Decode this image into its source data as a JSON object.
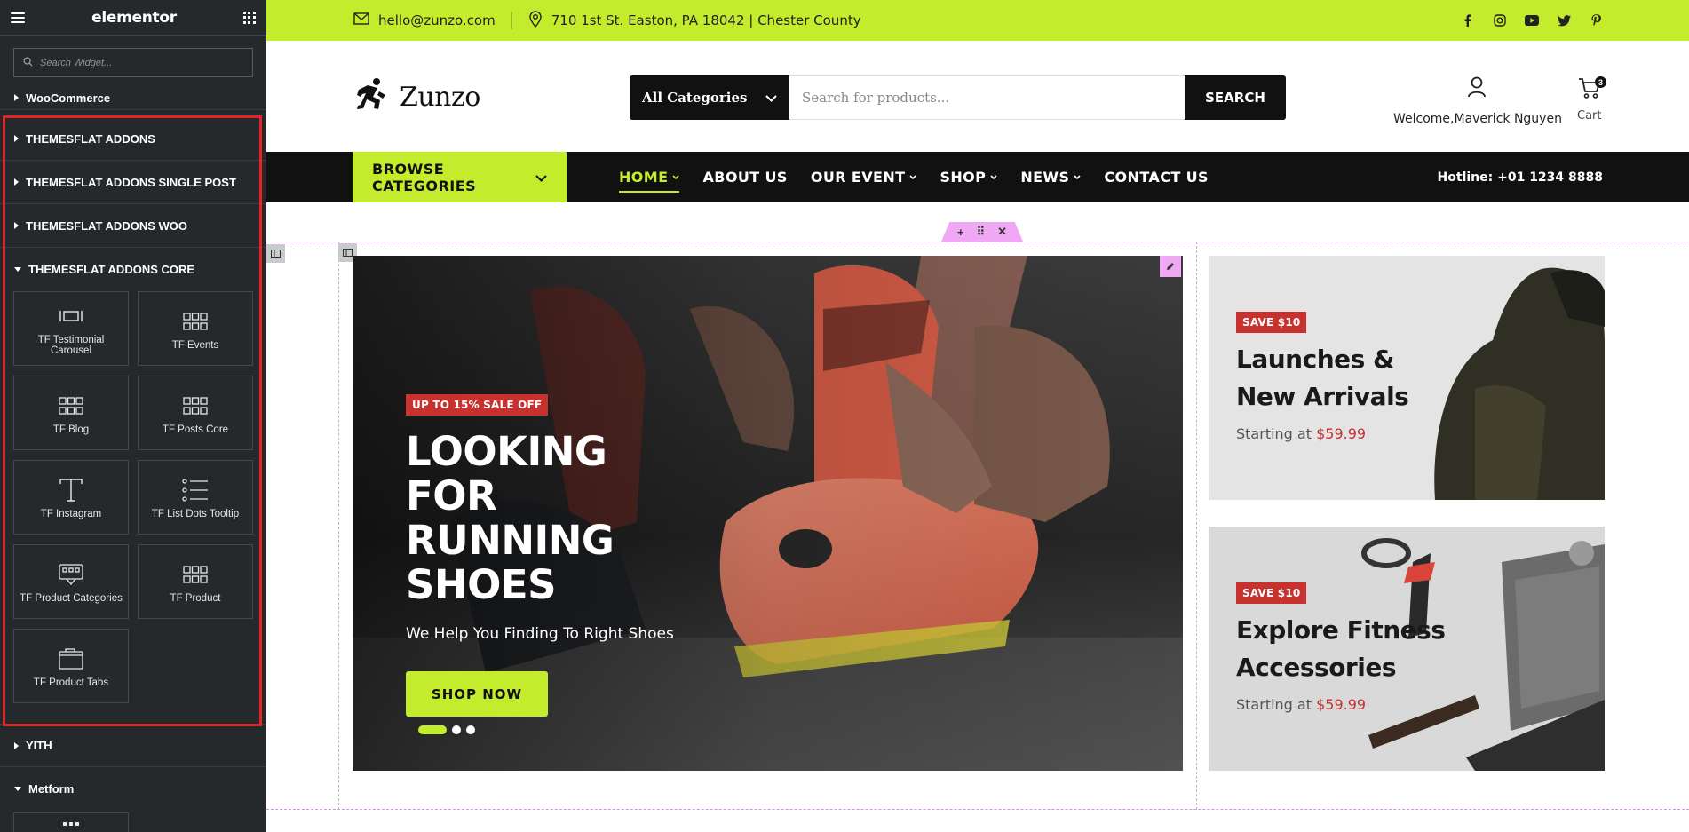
{
  "panel": {
    "brand": "elementor",
    "search_placeholder": "Search Widget...",
    "categories_top": [
      {
        "label": "WooCommerce"
      },
      {
        "label": "THEMESFLAT ADDONS"
      },
      {
        "label": "THEMESFLAT ADDONS SINGLE POST"
      },
      {
        "label": "THEMESFLAT ADDONS WOO"
      },
      {
        "label": "THEMESFLAT ADDONS CORE"
      }
    ],
    "widgets": [
      {
        "label": "TF Testimonial Carousel",
        "icon": "carousel-icon"
      },
      {
        "label": "TF Events",
        "icon": "grid-icon"
      },
      {
        "label": "TF Blog",
        "icon": "grid-icon"
      },
      {
        "label": "TF Posts Core",
        "icon": "grid-icon"
      },
      {
        "label": "TF Instagram",
        "icon": "text-icon"
      },
      {
        "label": "TF List Dots Tooltip",
        "icon": "list-icon"
      },
      {
        "label": "TF Product Categories",
        "icon": "product-categories-icon"
      },
      {
        "label": "TF Product",
        "icon": "grid-icon"
      },
      {
        "label": "TF Product Tabs",
        "icon": "tabs-icon"
      }
    ],
    "categories_bottom": [
      {
        "label": "YITH"
      },
      {
        "label": "Metform"
      }
    ],
    "highlight_color": "#e42527"
  },
  "site": {
    "colors": {
      "accent": "#c3ec2d",
      "dark": "#111111",
      "sale": "#c8322e"
    },
    "topbar": {
      "email": "hello@zunzo.com",
      "address": "710 1st St. Easton, PA 18042 | Chester County",
      "socials": [
        "facebook-icon",
        "instagram-icon",
        "youtube-icon",
        "twitter-icon",
        "pinterest-icon"
      ]
    },
    "header": {
      "logo_text": "Zunzo",
      "category_select": "All Categories",
      "search_placeholder": "Search for products...",
      "search_button": "SEARCH",
      "welcome": "Welcome,Maverick Nguyen",
      "cart_label": "Cart",
      "cart_count": "3"
    },
    "nav": {
      "browse": "BROWSE CATEGORIES",
      "items": [
        {
          "label": "HOME",
          "dropdown": true
        },
        {
          "label": "ABOUT US",
          "dropdown": false
        },
        {
          "label": "OUR EVENT",
          "dropdown": true
        },
        {
          "label": "SHOP",
          "dropdown": true
        },
        {
          "label": "NEWS",
          "dropdown": true
        },
        {
          "label": "CONTACT US",
          "dropdown": false
        }
      ],
      "hotline": "Hotline: +01 1234 8888"
    },
    "hero": {
      "badge": "UP TO 15% SALE OFF",
      "title": "LOOKING FOR RUNNING SHOES",
      "subtitle": "We Help You Finding To Right Shoes",
      "button": "SHOP NOW",
      "slides": 3,
      "active_slide": 1
    },
    "promos": [
      {
        "badge": "SAVE $10",
        "title_line1": "Launches &",
        "title_line2": "New Arrivals",
        "price_prefix": "Starting at",
        "price": "$59.99"
      },
      {
        "badge": "SAVE $10",
        "title_line1": "Explore Fitness",
        "title_line2": "Accessories",
        "price_prefix": "Starting at",
        "price": "$59.99"
      }
    ]
  }
}
